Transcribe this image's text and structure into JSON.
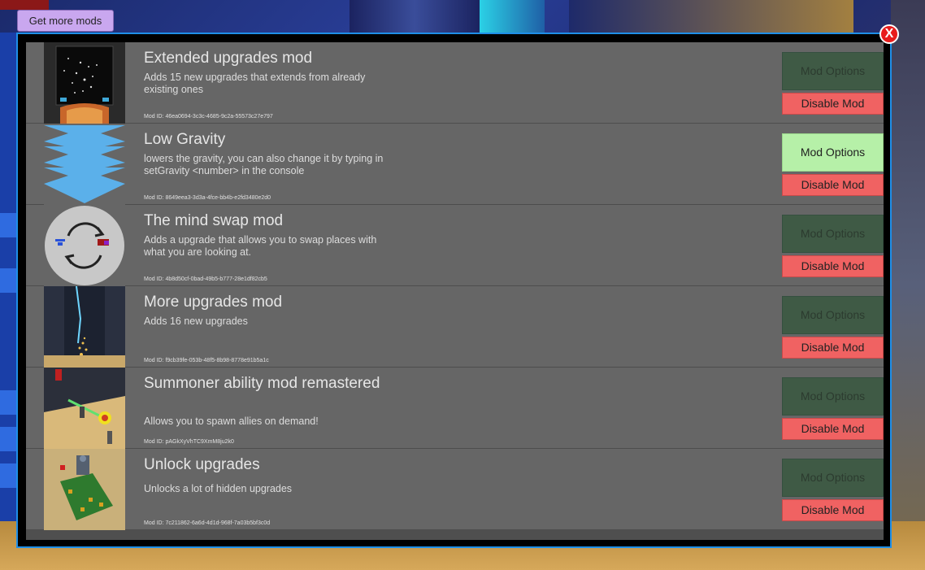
{
  "get_more_mods": "Get more mods",
  "close_label": "X",
  "mod_options_label": "Mod Options",
  "disable_label": "Disable Mod",
  "mods": [
    {
      "title": "Extended upgrades mod",
      "description": "Adds 15 new upgrades that extends from already existing ones",
      "mod_id": "Mod ID: 46ea0694-3c3c-4685-9c2a-55573c27e797",
      "thumb": "extended-thumbnail",
      "options_active": false
    },
    {
      "title": "Low Gravity",
      "description": "lowers the gravity, you can also change it by typing in setGravity <number> in the console",
      "mod_id": "Mod ID: 8649eea3-3d3a-4fce-bb4b-e2fd3480e2d0",
      "thumb": "down-arrows-thumbnail",
      "options_active": true
    },
    {
      "title": "The mind swap mod",
      "description": "Adds a upgrade that allows you to swap places with what you are looking at.",
      "mod_id": "Mod ID: 4b8d50cf-0bad-49b5-b777-28e1df82cb5",
      "thumb": "swap-thumbnail",
      "options_active": false
    },
    {
      "title": "More upgrades mod",
      "description": "Adds 16 new upgrades",
      "mod_id": "Mod ID: f9cb39fe-053b-48f5-8b98-8778e91b5a1c",
      "thumb": "more-upgrades-thumbnail",
      "options_active": false
    },
    {
      "title": "Summoner ability mod remastered",
      "description": "Allows you to spawn allies on demand!",
      "mod_id": "Mod ID: pAGkXyVhTC9XmM8ju2k0",
      "thumb": "summoner-thumbnail",
      "options_active": false
    },
    {
      "title": "Unlock upgrades",
      "description": "Unlocks a lot of hidden upgrades",
      "mod_id": "Mod ID: 7c211862-6a6d-4d1d-968f-7a03b5bf3c0d",
      "thumb": "unlock-thumbnail",
      "options_active": false
    }
  ],
  "colors": {
    "panel_border": "#1f8fe8",
    "options_button": "#3f5a45",
    "options_button_active": "#b6f0a8",
    "disable_button": "#f06262",
    "close_button": "#e81c1c"
  }
}
